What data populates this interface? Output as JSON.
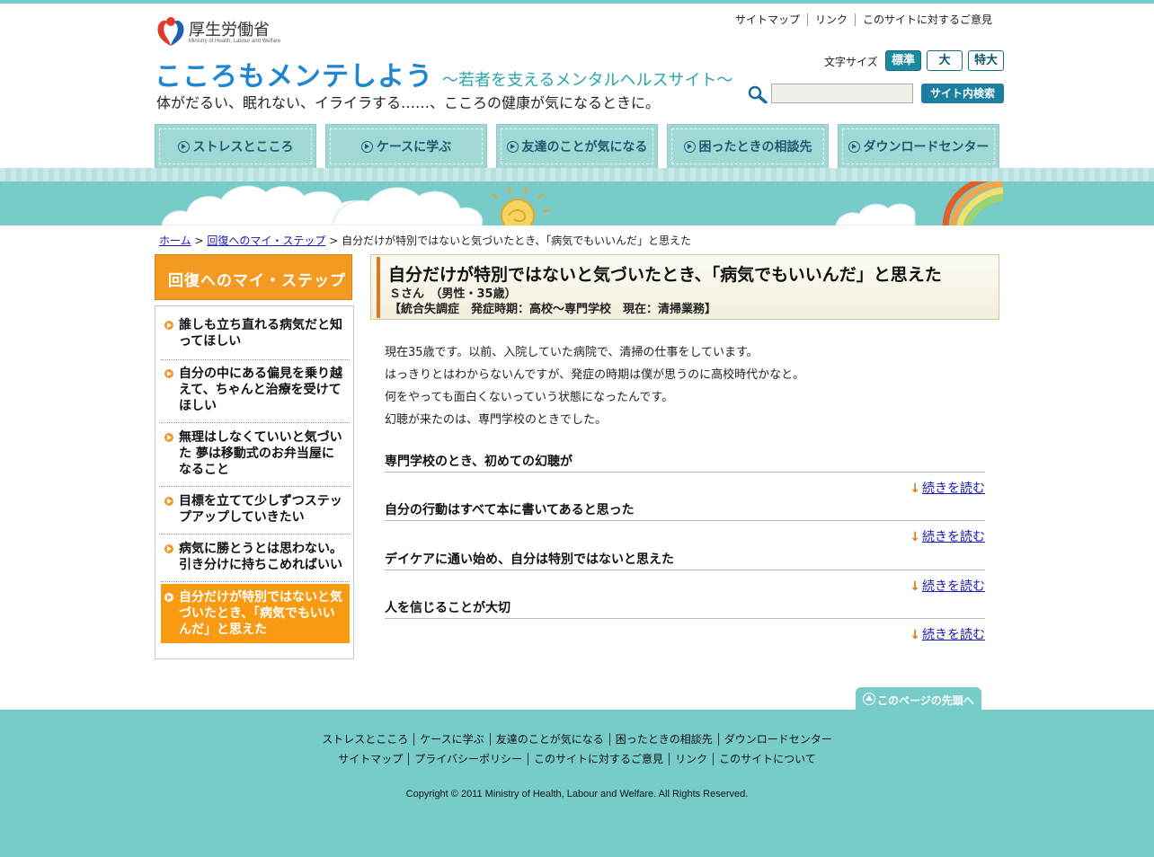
{
  "header": {
    "ministry_jp": "厚生労働省",
    "ministry_en": "Ministry of Health, Labour and Welfare",
    "site_title": "こころもメンテしよう",
    "site_subtitle": "〜若者を支えるメンタルヘルスサイト〜",
    "tagline": "体がだるい、眠れない、イライラする……、こころの健康が気になるときに。",
    "top_links": [
      "サイトマップ",
      "リンク",
      "このサイトに対するご意見"
    ],
    "font_size_label": "文字サイズ",
    "font_size_options": [
      "標準",
      "大",
      "特大"
    ],
    "search_button": "サイト内検索"
  },
  "nav": [
    "ストレスとこころ",
    "ケースに学ぶ",
    "友達のことが気になる",
    "困ったときの相談先",
    "ダウンロードセンター"
  ],
  "breadcrumb": {
    "home": "ホーム",
    "parent": "回復へのマイ・ステップ",
    "current": "自分だけが特別ではないと気づいたとき、「病気でもいいんだ」と思えた",
    "separator": ">"
  },
  "sidebar": {
    "title": "回復へのマイ・ステップ",
    "items": [
      "誰しも立ち直れる病気だと知ってほしい",
      "自分の中にある偏見を乗り越えて、ちゃんと治療を受けてほしい",
      "無理はしなくていいと気づいた 夢は移動式のお弁当屋になること",
      "目標を立てて少しずつステップアップしていきたい",
      "病気に勝とうとは思わない。引き分けに持ちこめればいい",
      "自分だけが特別ではないと気づいたとき、「病気でもいいんだ」と思えた"
    ],
    "active_index": 5
  },
  "article": {
    "title": "自分だけが特別ではないと気づいたとき、「病気でもいいんだ」と思えた",
    "person": "Ｓさん　（男性・35歳）",
    "meta": "【統合失調症　発症時期：高校～専門学校　現在：清掃業務】",
    "intro": [
      "現在35歳です。以前、入院していた病院で、清掃の仕事をしています。",
      "はっきりとはわからないんですが、発症の時期は僕が思うのに高校時代かなと。",
      "何をやっても面白くないっていう状態になったんです。",
      "幻聴が来たのは、専門学校のときでした。"
    ],
    "sections": [
      "専門学校のとき、初めての幻聴が",
      "自分の行動はすべて本に書いてあると思った",
      "デイケアに通い始め、自分は特別ではないと思えた",
      "人を信じることが大切"
    ],
    "more_label": "続きを読む"
  },
  "page_top": "このページの先頭へ",
  "footer": {
    "links_row1": [
      "ストレスとこころ",
      "ケースに学ぶ",
      "友達のことが気になる",
      "困ったときの相談先",
      "ダウンロードセンター"
    ],
    "links_row2": [
      "サイトマップ",
      "プライバシーポリシー",
      "このサイトに対するご意見",
      "リンク",
      "このサイトについて"
    ],
    "copyright": "Copyright © 2011 Ministry of Health, Labour and Welfare. All Rights Reserved."
  },
  "colors": {
    "teal": "#77ccca",
    "orange": "#f39a22",
    "nav_bg": "#9fd8d4",
    "title_blue": "#1f86d4"
  }
}
